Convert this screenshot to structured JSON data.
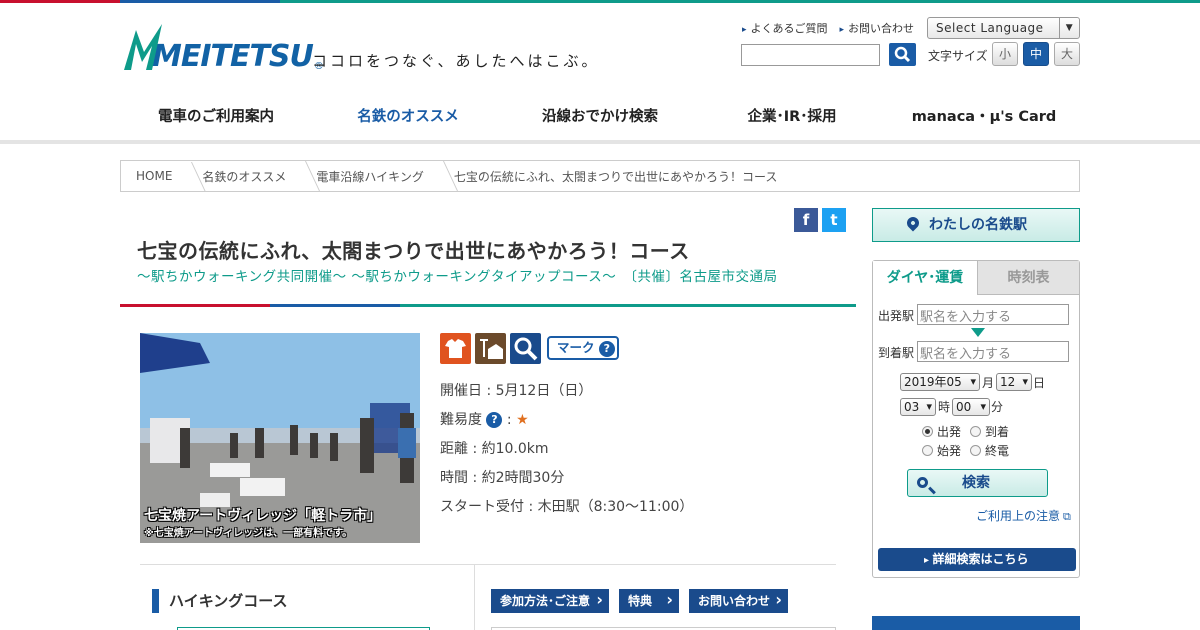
{
  "header": {
    "brand": "MEITETSU",
    "tagline": "ココロをつなぐ、あしたへはこぶ。",
    "util_links": [
      "よくあるご質問",
      "お問い合わせ"
    ],
    "language_select": "Select Language",
    "font_size_label": "文字サイズ",
    "font_sizes": [
      "小",
      "中",
      "大"
    ],
    "font_size_selected": "中",
    "top_bar_colors": [
      "#c8102e",
      "#1a5ca6",
      "#0e9b8a"
    ]
  },
  "nav": {
    "items": [
      "電車のご利用案内",
      "名鉄のオススメ",
      "沿線おでかけ検索",
      "企業･IR･採用",
      "manaca・μ's Card"
    ],
    "active": "名鉄のオススメ"
  },
  "breadcrumb": [
    "HOME",
    "名鉄のオススメ",
    "電車沿線ハイキング",
    "七宝の伝統にふれ、太閤まつりで出世にあやかろう！コース"
  ],
  "share": {
    "facebook": "f",
    "twitter": "t"
  },
  "course": {
    "title": "七宝の伝統にふれ、太閤まつりで出世にあやかろう！コース",
    "subtitle": "～駅ちかウォーキング共同開催～ ～駅ちかウォーキングタイアップコース～　〔共催〕名古屋市交通局",
    "photo_caption": "七宝焼アートヴィレッジ「軽トラ市」",
    "photo_note": "※七宝焼アートヴィレッジは、一部有料です。",
    "mark_button": "マーク",
    "date": "開催日 : 5月12日（日）",
    "difficulty_label": "難易度",
    "difficulty_sep": ":",
    "difficulty_stars": "★",
    "distance": "距離 : 約10.0km",
    "duration": "時間 : 約2時間30分",
    "start": "スタート受付 : 木田駅（8:30～11:00）"
  },
  "sections": {
    "hiking_course": "ハイキングコース",
    "tabs": [
      "参加方法･ご注意",
      "特典",
      "お問い合わせ"
    ]
  },
  "sidebar": {
    "my_station": "わたしの名鉄駅",
    "tabs": [
      "ダイヤ･運賃",
      "時刻表"
    ],
    "active_tab": "ダイヤ･運賃",
    "from_label": "出発駅",
    "to_label": "到着駅",
    "station_placeholder": "駅名を入力する",
    "year_month": "2019年05",
    "month_unit": "月",
    "day": "12",
    "day_unit": "日",
    "hour": "03",
    "hour_unit": "時",
    "minute": "00",
    "minute_unit": "分",
    "options": [
      "出発",
      "到着",
      "始発",
      "終電"
    ],
    "selected_option": "出発",
    "search_button": "検索",
    "notice_link": "ご利用上の注意",
    "detail_search": "詳細検索はこちら"
  }
}
